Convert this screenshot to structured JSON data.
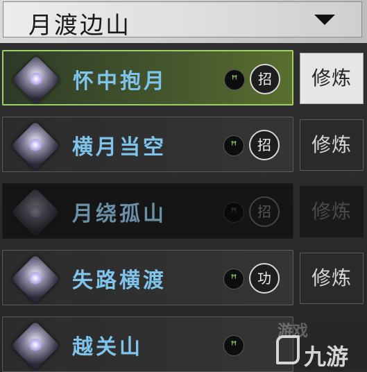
{
  "header": {
    "title": "月渡边山"
  },
  "skills": [
    {
      "name": "怀中抱月",
      "tag": "招",
      "button": "修炼",
      "state": "selected"
    },
    {
      "name": "横月当空",
      "tag": "招",
      "button": "修炼",
      "state": "normal"
    },
    {
      "name": "月绕孤山",
      "tag": "招",
      "button": "修炼",
      "state": "locked"
    },
    {
      "name": "失路横渡",
      "tag": "功",
      "button": "修炼",
      "state": "normal"
    },
    {
      "name": "越关山",
      "tag": "",
      "button": "",
      "state": "normal"
    }
  ],
  "swirl_icon": "swirl-icon",
  "watermark": {
    "text": "九游",
    "faded_text": "游戏"
  },
  "colors": {
    "skill_name": "#7fc4ea",
    "selected_border": "#9bd36a"
  }
}
